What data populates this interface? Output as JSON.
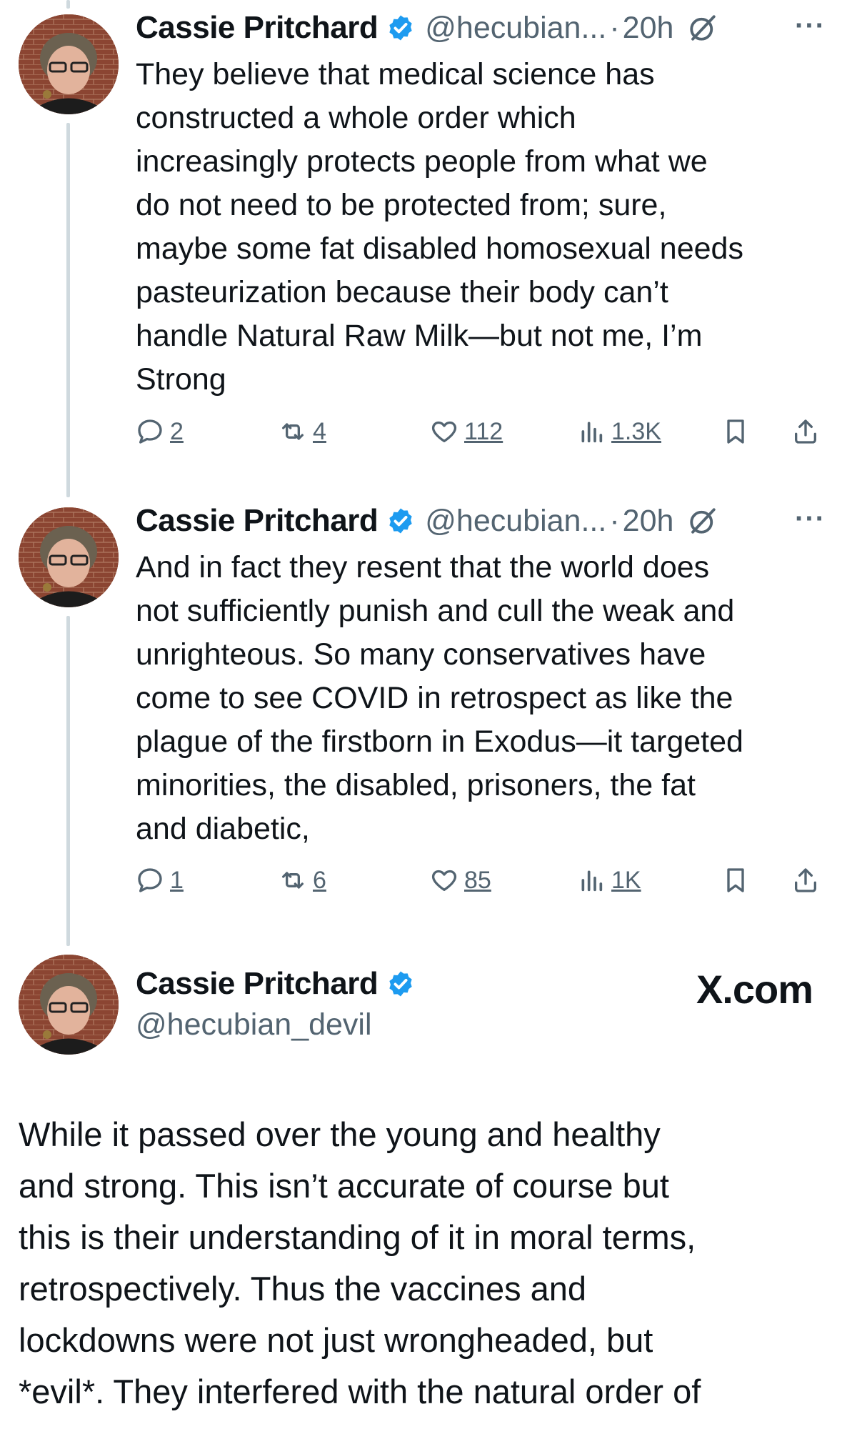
{
  "tweets": [
    {
      "name": "Cassie Pritchard",
      "handle": "@hecubian...",
      "separator": "·",
      "time": "20h",
      "more": "···",
      "body": "They believe that medical science has\nconstructed a whole order which\nincreasingly protects people from what we\ndo not need to be protected from; sure,\nmaybe some fat disabled homosexual needs\npasteurization because their body can’t\nhandle Natural Raw Milk—but not me, I’m\nStrong",
      "replies": "2",
      "reposts": "4",
      "likes": "112",
      "views": "1.3K"
    },
    {
      "name": "Cassie Pritchard",
      "handle": "@hecubian...",
      "separator": "·",
      "time": "20h",
      "more": "···",
      "body": "And in fact they resent that the world does\nnot sufficiently punish and cull the weak and\nunrighteous. So many conservatives have\ncome to see COVID in retrospect as like the\nplague of the firstborn in Exodus—it targeted\nminorities, the disabled, prisoners, the fat\nand diabetic,",
      "replies": "1",
      "reposts": "6",
      "likes": "85",
      "views": "1K"
    }
  ],
  "card": {
    "name": "Cassie Pritchard",
    "handle": "@hecubian_devil",
    "site": "X.com",
    "body": "While it passed over the young and healthy\nand strong. This isn’t accurate of course but\nthis is their understanding of it in moral terms,\nretrospectively. Thus the vaccines and\nlockdowns were not just wrongheaded, but\n*evil*. They interfered with the natural order of"
  },
  "colors": {
    "text": "#0f1419",
    "secondary": "#536471",
    "verified": "#1d9bf0",
    "thread_line": "#cfd9de"
  },
  "icons": [
    "reply-icon",
    "repost-icon",
    "like-icon",
    "views-icon",
    "bookmark-icon",
    "share-icon",
    "verified-badge-icon",
    "grok-icon",
    "more-icon"
  ]
}
